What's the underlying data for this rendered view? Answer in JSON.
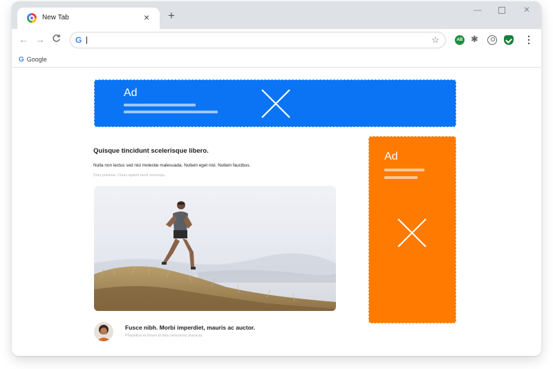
{
  "browser": {
    "tab_title": "New Tab",
    "tab_close": "×",
    "new_tab": "+",
    "window_minimize": "—",
    "window_close": "✕",
    "nav_back": "←",
    "nav_forward": "→",
    "nav_reload": "C",
    "omnibox_icon": "G",
    "omnibox_value": "|",
    "bookmark_star": "☆",
    "extension_badge": "AB",
    "puzzle": "✱",
    "menu": "⋮",
    "bookmarks": [
      {
        "icon": "G",
        "label": "Google"
      }
    ]
  },
  "ads": {
    "banner": {
      "label": "Ad",
      "color": "#0a74f5"
    },
    "side": {
      "label": "Ad",
      "color": "#ff7a00"
    }
  },
  "article": {
    "title": "Quisque tincidunt scelerisque libero.",
    "text": "Nulla non lectus sed nisl molestie malesuada. Nullam eget nisl. Nullam faucibus.",
    "subtext": "Duis pulvinar. Class aptent taciti sociosqu."
  },
  "author": {
    "title": "Fusce nibh. Morbi imperdiet, mauris ac auctor.",
    "subtitle": "Phasellus et lorem id felis nonummy placerat."
  }
}
